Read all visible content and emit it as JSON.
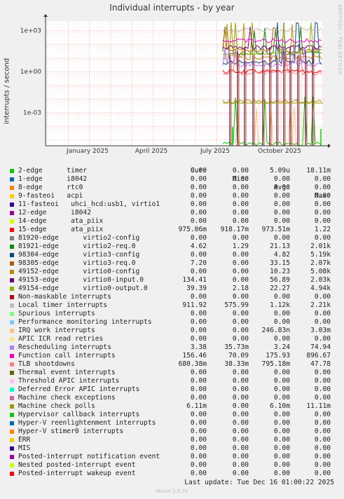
{
  "title": "Individual interrupts - by year",
  "side_label": "RRDTOOL / TOBI OETIKER",
  "ylabel": "interrupts / second",
  "footer": "Last update: Tue Dec 16 01:00:22 2025",
  "generator": "Munin 2.0.76",
  "legend_header": {
    "cur": "Cur:",
    "min": "Min:",
    "avg": "Avg:",
    "max": "Max:"
  },
  "chart_data": {
    "type": "line",
    "title": "Individual interrupts - by year",
    "ylabel": "interrupts / second",
    "y_scale": "log",
    "yticks": [
      "1e+03",
      "1e+00",
      "1e-03"
    ],
    "xticks": [
      "January 2025",
      "April 2025",
      "July 2025",
      "October 2025"
    ],
    "grid": true,
    "legend_placement": "bottom",
    "series": [
      {
        "name": "2-edge      timer",
        "color": "#00cc00",
        "cur": "0.00",
        "min": "0.00",
        "avg": "5.09u",
        "max": "18.11m"
      },
      {
        "name": "1-edge      i8042",
        "color": "#0066b3",
        "cur": "0.00",
        "min": "0.00",
        "avg": "0.00",
        "max": "0.00"
      },
      {
        "name": "8-edge      rtc0",
        "color": "#ff8000",
        "cur": "0.00",
        "min": "0.00",
        "avg": "0.00",
        "max": "0.00"
      },
      {
        "name": "9-fasteoi   acpi",
        "color": "#ffcc00",
        "cur": "0.00",
        "min": "0.00",
        "avg": "0.00",
        "max": "0.00"
      },
      {
        "name": "11-fasteoi   uhci_hcd:usb1, virtio1",
        "color": "#330099",
        "cur": "0.00",
        "min": "0.00",
        "avg": "0.00",
        "max": "0.00"
      },
      {
        "name": "12-edge      i8042",
        "color": "#990099",
        "cur": "0.00",
        "min": "0.00",
        "avg": "0.00",
        "max": "0.00"
      },
      {
        "name": "14-edge      ata_piix",
        "color": "#ccff00",
        "cur": "0.00",
        "min": "0.00",
        "avg": "0.00",
        "max": "0.00"
      },
      {
        "name": "15-edge      ata_piix",
        "color": "#ff0000",
        "cur": "975.06m",
        "min": "918.17m",
        "avg": "973.51m",
        "max": "1.22"
      },
      {
        "name": "81920-edge      virtio2-config",
        "color": "#808080",
        "cur": "0.00",
        "min": "0.00",
        "avg": "0.00",
        "max": "0.00"
      },
      {
        "name": "81921-edge      virtio2-req.0",
        "color": "#008f00",
        "cur": "4.62",
        "min": "1.29",
        "avg": "21.13",
        "max": "2.01k"
      },
      {
        "name": "98304-edge      virtio3-config",
        "color": "#00487d",
        "cur": "0.00",
        "min": "0.00",
        "avg": "4.82",
        "max": "5.19k"
      },
      {
        "name": "98305-edge      virtio3-req.0",
        "color": "#b35a00",
        "cur": "7.20",
        "min": "0.00",
        "avg": "33.15",
        "max": "2.07k"
      },
      {
        "name": "49152-edge      virtio0-config",
        "color": "#b38f00",
        "cur": "0.00",
        "min": "0.00",
        "avg": "10.23",
        "max": "5.08k"
      },
      {
        "name": "49153-edge      virtio0-input.0",
        "color": "#6b006b",
        "cur": "134.41",
        "min": "0.00",
        "avg": "56.89",
        "max": "2.03k"
      },
      {
        "name": "49154-edge      virtio0-output.0",
        "color": "#8fb300",
        "cur": "39.39",
        "min": "2.18",
        "avg": "22.27",
        "max": "4.94k"
      },
      {
        "name": "Non-maskable interrupts",
        "color": "#b30000",
        "cur": "0.00",
        "min": "0.00",
        "avg": "0.00",
        "max": "0.00"
      },
      {
        "name": "Local timer interrupts",
        "color": "#bebebe",
        "cur": "911.92",
        "min": "575.99",
        "avg": "1.12k",
        "max": "2.21k"
      },
      {
        "name": "Spurious interrupts",
        "color": "#80ff80",
        "cur": "0.00",
        "min": "0.00",
        "avg": "0.00",
        "max": "0.00"
      },
      {
        "name": "Performance monitoring interrupts",
        "color": "#80c9ff",
        "cur": "0.00",
        "min": "0.00",
        "avg": "0.00",
        "max": "0.00"
      },
      {
        "name": "IRQ work interrupts",
        "color": "#ffc080",
        "cur": "0.00",
        "min": "0.00",
        "avg": "246.83n",
        "max": "3.03m"
      },
      {
        "name": "APIC ICR read retries",
        "color": "#ffe680",
        "cur": "0.00",
        "min": "0.00",
        "avg": "0.00",
        "max": "0.00"
      },
      {
        "name": "Rescheduling interrupts",
        "color": "#aa80ff",
        "cur": "3.38",
        "min": "35.73m",
        "avg": "3.24",
        "max": "74.94"
      },
      {
        "name": "Function call interrupts",
        "color": "#ee00cc",
        "cur": "156.46",
        "min": "70.09",
        "avg": "175.93",
        "max": "896.67"
      },
      {
        "name": "TLB shootdowns",
        "color": "#ff8080",
        "cur": "680.38m",
        "min": "38.33m",
        "avg": "795.18m",
        "max": "47.78"
      },
      {
        "name": "Thermal event interrupts",
        "color": "#666600",
        "cur": "0.00",
        "min": "0.00",
        "avg": "0.00",
        "max": "0.00"
      },
      {
        "name": "Threshold APIC interrupts",
        "color": "#ffbfff",
        "cur": "0.00",
        "min": "0.00",
        "avg": "0.00",
        "max": "0.00"
      },
      {
        "name": "Deferred Error APIC interrupts",
        "color": "#00ffcc",
        "cur": "0.00",
        "min": "0.00",
        "avg": "0.00",
        "max": "0.00"
      },
      {
        "name": "Machine check exceptions",
        "color": "#cc6699",
        "cur": "0.00",
        "min": "0.00",
        "avg": "0.00",
        "max": "0.00"
      },
      {
        "name": "Machine check polls",
        "color": "#999900",
        "cur": "6.11m",
        "min": "0.00",
        "avg": "6.10m",
        "max": "11.11m"
      },
      {
        "name": "Hypervisor callback interrupts",
        "color": "#00cc00",
        "cur": "0.00",
        "min": "0.00",
        "avg": "0.00",
        "max": "0.00"
      },
      {
        "name": "Hyper-V reenlightenment interrupts",
        "color": "#0066b3",
        "cur": "0.00",
        "min": "0.00",
        "avg": "0.00",
        "max": "0.00"
      },
      {
        "name": "Hyper-V stimer0 interrupts",
        "color": "#ff8000",
        "cur": "0.00",
        "min": "0.00",
        "avg": "0.00",
        "max": "0.00"
      },
      {
        "name": "ERR",
        "color": "#ffcc00",
        "cur": "0.00",
        "min": "0.00",
        "avg": "0.00",
        "max": "0.00"
      },
      {
        "name": "MIS",
        "color": "#330099",
        "cur": "0.00",
        "min": "0.00",
        "avg": "0.00",
        "max": "0.00"
      },
      {
        "name": "Posted-interrupt notification event",
        "color": "#990099",
        "cur": "0.00",
        "min": "0.00",
        "avg": "0.00",
        "max": "0.00"
      },
      {
        "name": "Nested posted-interrupt event",
        "color": "#ccff00",
        "cur": "0.00",
        "min": "0.00",
        "avg": "0.00",
        "max": "0.00"
      },
      {
        "name": "Posted-interrupt wakeup event",
        "color": "#ff0000",
        "cur": "0.00",
        "min": "0.00",
        "avg": "0.00",
        "max": "0.00"
      }
    ]
  }
}
